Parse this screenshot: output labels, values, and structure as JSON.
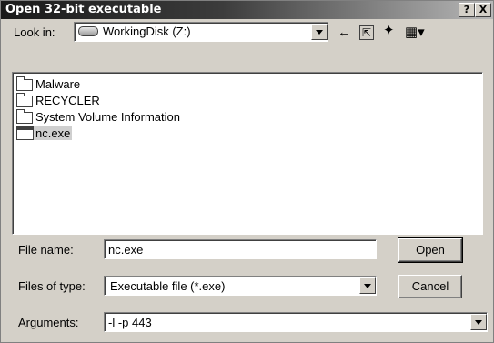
{
  "window": {
    "title": "Open 32-bit executable",
    "help_label": "?",
    "close_label": "X"
  },
  "look_in": {
    "label": "Look in:",
    "value": "WorkingDisk (Z:)"
  },
  "toolbar": {
    "back_glyph": "←",
    "up_glyph": "⇱",
    "new_folder_glyph": "✦",
    "view_glyph": "▦▾"
  },
  "files": [
    {
      "name": "Malware",
      "type": "folder"
    },
    {
      "name": "RECYCLER",
      "type": "folder"
    },
    {
      "name": "System Volume Information",
      "type": "folder"
    },
    {
      "name": "nc.exe",
      "type": "exe",
      "selected": true
    }
  ],
  "file_name": {
    "label": "File name:",
    "value": "nc.exe"
  },
  "file_type": {
    "label": "Files of type:",
    "value": "Executable file (*.exe)"
  },
  "arguments": {
    "label": "Arguments:",
    "value": "-l -p 443"
  },
  "buttons": {
    "open": "Open",
    "cancel": "Cancel"
  }
}
